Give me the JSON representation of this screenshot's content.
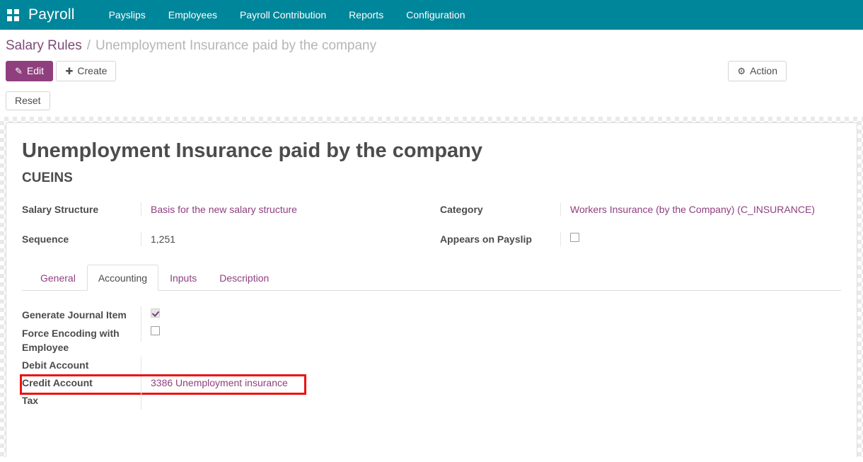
{
  "navbar": {
    "apps_icon": "apps-grid-icon",
    "brand": "Payroll",
    "menu": [
      {
        "label": "Payslips"
      },
      {
        "label": "Employees"
      },
      {
        "label": "Payroll Contribution"
      },
      {
        "label": "Reports"
      },
      {
        "label": "Configuration"
      }
    ]
  },
  "breadcrumb": {
    "parent": "Salary Rules",
    "separator": "/",
    "current": "Unemployment Insurance paid by the company"
  },
  "control_panel": {
    "edit_icon": "pencil-icon",
    "edit_label": "Edit",
    "create_icon": "plus-icon",
    "create_label": "Create",
    "action_icon": "gear-icon",
    "action_label": "Action",
    "reset_label": "Reset"
  },
  "record": {
    "title": "Unemployment Insurance paid by the company",
    "code": "CUEINS",
    "fields_left": [
      {
        "label": "Salary Structure",
        "value": "Basis for the new salary structure",
        "type": "link"
      },
      {
        "label": "Sequence",
        "value": "1,251",
        "type": "text"
      }
    ],
    "fields_right": [
      {
        "label": "Category",
        "value": "Workers Insurance (by the Company) (C_INSURANCE)",
        "type": "link"
      },
      {
        "label": "Appears on Payslip",
        "value": "",
        "type": "checkbox",
        "checked": false
      }
    ]
  },
  "tabs": [
    {
      "label": "General",
      "active": false
    },
    {
      "label": "Accounting",
      "active": true
    },
    {
      "label": "Inputs",
      "active": false
    },
    {
      "label": "Description",
      "active": false
    }
  ],
  "accounting": {
    "rows": [
      {
        "label": "Generate Journal Item",
        "value": "",
        "type": "checkbox",
        "checked": true
      },
      {
        "label": "Force Encoding with Employee",
        "value": "",
        "type": "checkbox",
        "checked": false
      },
      {
        "label": "Debit Account",
        "value": "",
        "type": "text"
      },
      {
        "label": "Credit Account",
        "value": "3386 Unemployment insurance",
        "type": "link",
        "highlighted": true
      },
      {
        "label": "Tax",
        "value": "",
        "type": "text"
      }
    ]
  },
  "colors": {
    "navbar_teal": "#00869a",
    "accent_purple": "#8f3f7e",
    "highlight_red": "#ee1111",
    "text_gray": "#4c4c4c"
  }
}
